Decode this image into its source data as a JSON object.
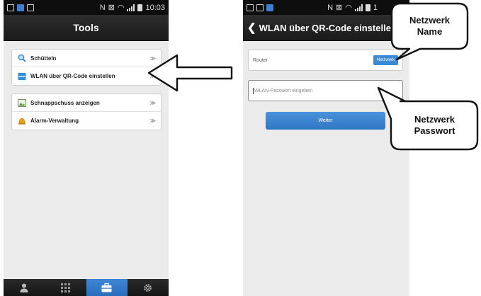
{
  "phone1": {
    "status": {
      "time": "10:03"
    },
    "title": "Tools",
    "group1": [
      {
        "label": "Schütteln",
        "icon": "magnifier-icon"
      },
      {
        "label": "WLAN über QR-Code einstellen",
        "icon": "qr-scan-icon"
      }
    ],
    "group2": [
      {
        "label": "Schnappschuss anzeigen",
        "icon": "image-icon"
      },
      {
        "label": "Alarm-Verwaltung",
        "icon": "alarm-bell-icon"
      }
    ],
    "chevron": "≫",
    "tabs": [
      {
        "icon": "person-icon",
        "active": false
      },
      {
        "icon": "grid-icon",
        "active": false
      },
      {
        "icon": "toolbox-icon",
        "active": true
      },
      {
        "icon": "gear-icon",
        "active": false
      }
    ]
  },
  "phone2": {
    "status": {
      "time": "1"
    },
    "title": "WLAN über QR-Code einstellen",
    "router_value": "Router",
    "network_button": "Netzwerk",
    "password_placeholder": "WLAN-Passwort eingeben",
    "next_button": "Weiter"
  },
  "callouts": {
    "network_name": [
      "Netzwerk",
      "Name"
    ],
    "network_password": [
      "Netzwerk",
      "Passwort"
    ]
  },
  "colors": {
    "accent": "#3a8ad6",
    "titlebar": "#1f1f1f",
    "background": "#ebebeb"
  }
}
